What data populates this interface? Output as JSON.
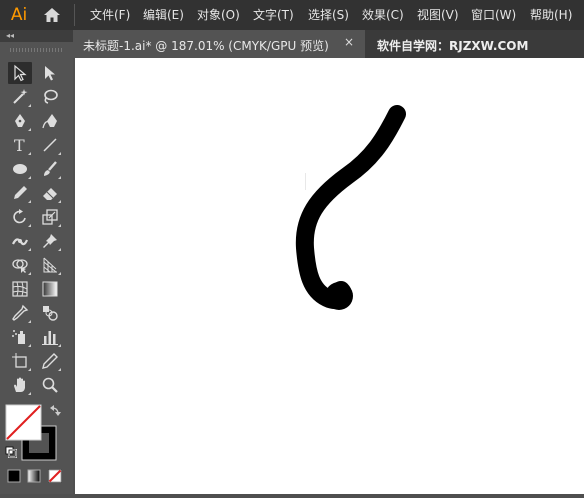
{
  "app": {
    "logo_text": "Ai"
  },
  "menu": {
    "items": [
      {
        "label": "文件(F)"
      },
      {
        "label": "编辑(E)"
      },
      {
        "label": "对象(O)"
      },
      {
        "label": "文字(T)"
      },
      {
        "label": "选择(S)"
      },
      {
        "label": "效果(C)"
      },
      {
        "label": "视图(V)"
      },
      {
        "label": "窗口(W)"
      },
      {
        "label": "帮助(H)"
      }
    ]
  },
  "tabs": {
    "document": {
      "title": "未标题-1.ai* @ 187.01% (CMYK/GPU 预览)",
      "close": "×"
    },
    "watermark": "软件自学网：RJZXW.COM"
  },
  "toolbar": {
    "collapse": "◂◂",
    "tools": [
      {
        "name": "selection-tool",
        "icon": "arrow-icon",
        "active": true
      },
      {
        "name": "direct-selection-tool",
        "icon": "white-arrow-icon"
      },
      {
        "name": "magic-wand-tool",
        "icon": "magic-wand-icon"
      },
      {
        "name": "lasso-tool",
        "icon": "lasso-icon"
      },
      {
        "name": "pen-tool",
        "icon": "pen-icon"
      },
      {
        "name": "curvature-tool",
        "icon": "curvature-icon"
      },
      {
        "name": "type-tool",
        "icon": "type-icon"
      },
      {
        "name": "line-tool",
        "icon": "line-icon"
      },
      {
        "name": "ellipse-tool",
        "icon": "ellipse-icon"
      },
      {
        "name": "paintbrush-tool",
        "icon": "brush-icon"
      },
      {
        "name": "pencil-tool",
        "icon": "pencil-icon"
      },
      {
        "name": "eraser-tool",
        "icon": "eraser-icon"
      },
      {
        "name": "rotate-tool",
        "icon": "rotate-icon"
      },
      {
        "name": "scale-tool",
        "icon": "scale-icon"
      },
      {
        "name": "width-tool",
        "icon": "width-icon"
      },
      {
        "name": "puppet-warp-tool",
        "icon": "pin-icon"
      },
      {
        "name": "shape-builder-tool",
        "icon": "shape-builder-icon"
      },
      {
        "name": "perspective-grid-tool",
        "icon": "perspective-icon"
      },
      {
        "name": "mesh-tool",
        "icon": "mesh-icon"
      },
      {
        "name": "gradient-tool",
        "icon": "gradient-icon"
      },
      {
        "name": "eyedropper-tool",
        "icon": "eyedropper-icon"
      },
      {
        "name": "blend-tool",
        "icon": "blend-icon"
      },
      {
        "name": "symbol-sprayer-tool",
        "icon": "sprayer-icon"
      },
      {
        "name": "column-graph-tool",
        "icon": "graph-icon"
      },
      {
        "name": "artboard-tool",
        "icon": "artboard-icon"
      },
      {
        "name": "slice-tool",
        "icon": "slice-icon"
      },
      {
        "name": "hand-tool",
        "icon": "hand-icon"
      },
      {
        "name": "zoom-tool",
        "icon": "zoom-icon"
      }
    ]
  },
  "colors": {
    "fill": "none",
    "stroke": "#000000",
    "canvas": "#ffffff",
    "logo": "#ff9a00"
  }
}
